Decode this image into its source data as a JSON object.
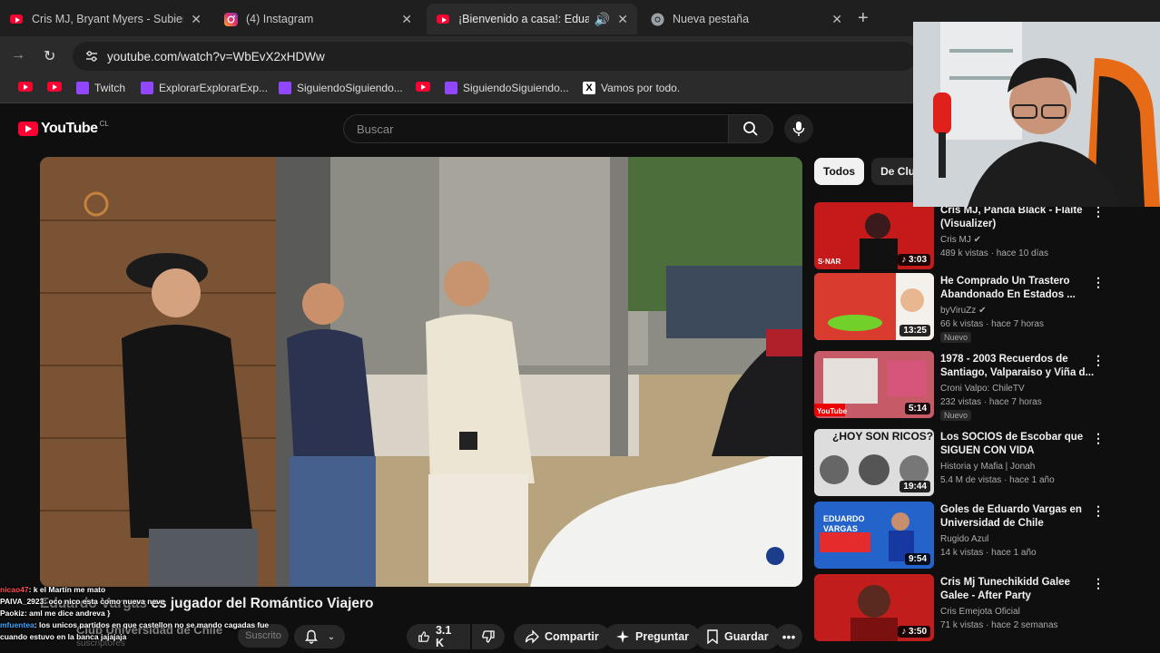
{
  "browser": {
    "tabs": [
      {
        "title": "Cris MJ, Bryant Myers - Subiero",
        "icon": "youtube-icon"
      },
      {
        "title": "(4) Instagram",
        "icon": "instagram-icon"
      },
      {
        "title": "¡Bienvenido a casa!: Eduardo",
        "icon": "youtube-icon",
        "active": true
      },
      {
        "title": "Nueva pestaña",
        "icon": "chrome-icon"
      }
    ],
    "url": "youtube.com/watch?v=WbEvX2xHDWw",
    "bookmarks": [
      "Twitch",
      "ExplorarExplorarExp...",
      "SiguiendoSiguiendo...",
      "SiguiendoSiguiendo...",
      "Vamos por todo."
    ]
  },
  "youtube": {
    "logo_text": "YouTube",
    "country": "CL",
    "search_placeholder": "Buscar",
    "video": {
      "title_visible": "es jugador del Romántico Viajero",
      "title_overlay": "Eduardo Vargas",
      "channel": "Club Universidad de Chile",
      "subs": "suscriptores",
      "subscribed_label": "Suscrito",
      "likes": "3.1 K",
      "share": "Compartir",
      "ask": "Preguntar",
      "save": "Guardar"
    },
    "chips": [
      "Todos",
      "De Club U"
    ],
    "recommendations": [
      {
        "title": "Cris MJ, Panda Black - Flaite (Visualizer)",
        "channel": "Cris MJ",
        "verified": true,
        "views": "489 k vistas · hace 10 días",
        "duration": "3:03",
        "new": false,
        "thumb_color": "#c41a1a"
      },
      {
        "title": "He Comprado Un Trastero Abandonado En Estados ...",
        "channel": "byViruZz",
        "verified": true,
        "views": "66 k vistas · hace 7 horas",
        "duration": "13:25",
        "new": true,
        "thumb_color": "#d93b2e"
      },
      {
        "title": "1978 - 2003 Recuerdos de Santiago, Valparaiso y Viña d...",
        "channel": "Croni Valpo: ChileTV",
        "verified": false,
        "views": "232 vistas · hace 7 horas",
        "duration": "5:14",
        "new": true,
        "thumb_color": "#8a4a55"
      },
      {
        "title": "Los SOCIOS de Escobar que SIGUEN CON VIDA",
        "channel": "Historia y Mafia | Jonah",
        "verified": false,
        "views": "5.4 M de vistas · hace 1 año",
        "duration": "19:44",
        "new": false,
        "thumb_color": "#2a2a2a",
        "overlay": "¿HOY SON RICOS?"
      },
      {
        "title": "Goles de Eduardo Vargas en Universidad de Chile",
        "channel": "Rugido Azul",
        "verified": false,
        "views": "14 k vistas · hace 1 año",
        "duration": "9:54",
        "new": false,
        "thumb_color": "#1b58b5",
        "overlay": "EDUARDO VARGAS"
      },
      {
        "title": "Cris Mj Tunechikidd Galee Galee - After Party",
        "channel": "Cris Emejota Oficial",
        "verified": false,
        "views": "71 k vistas · hace 2 semanas",
        "duration": "3:50",
        "new": false,
        "thumb_color": "#c21d1d"
      }
    ],
    "new_badge": "Nuevo"
  },
  "chat": [
    {
      "user": "nicao47",
      "msg": ": k el Martín me mato",
      "color": "u1"
    },
    {
      "user": "PAIVA_2923",
      "msg": ": oco nico esta como nueva neve",
      "color": ""
    },
    {
      "user": "Paokiz",
      "msg": ": aml me dice andreva }",
      "color": ""
    },
    {
      "user": "mfuentea",
      "msg": ": los unicos partidos en que castellon no se mando cagadas fue",
      "color": "u2"
    },
    {
      "user": "",
      "msg": "cuando estuvo en la banca jajajaja",
      "color": ""
    }
  ]
}
